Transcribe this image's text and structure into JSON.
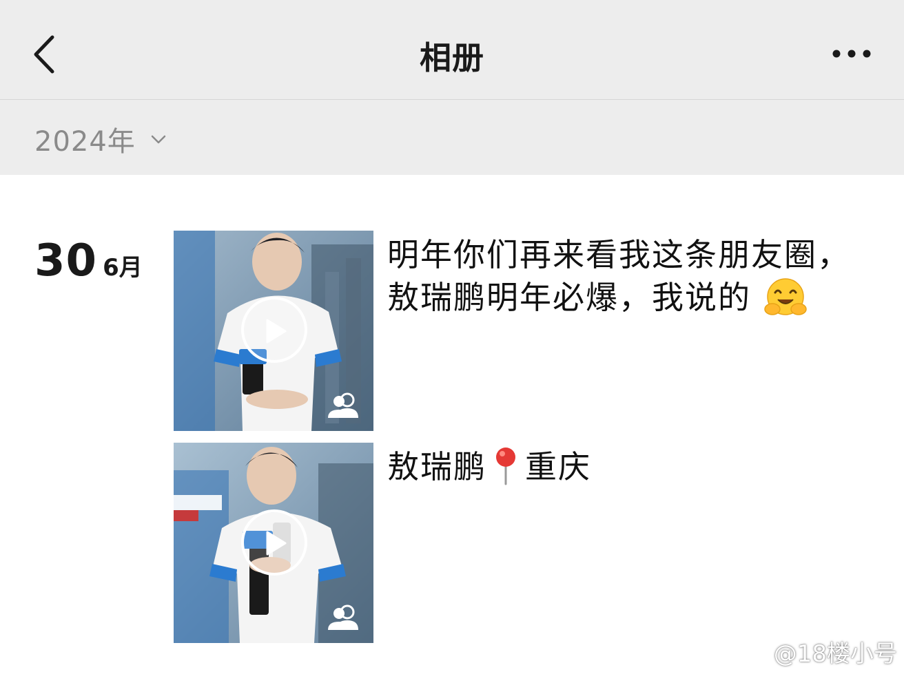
{
  "nav": {
    "title": "相册"
  },
  "filter": {
    "year": "2024年"
  },
  "date": {
    "day": "30",
    "month": "6月"
  },
  "posts": [
    {
      "text": "明年你们再来看我这条朋友圈，敖瑞鹏明年必爆，我说的",
      "emoji": "hugging-face-emoji",
      "media": "video",
      "visibility_icon": "friends-icon"
    },
    {
      "text_before": "敖瑞鹏",
      "location_icon": "pin-icon",
      "text_after": "重庆",
      "media": "video",
      "visibility_icon": "friends-icon"
    }
  ],
  "watermark": {
    "text": "@18楼小号"
  },
  "colors": {
    "nav_bg": "#ededed",
    "muted_text": "#8a8a8a",
    "primary_text": "#111111"
  }
}
